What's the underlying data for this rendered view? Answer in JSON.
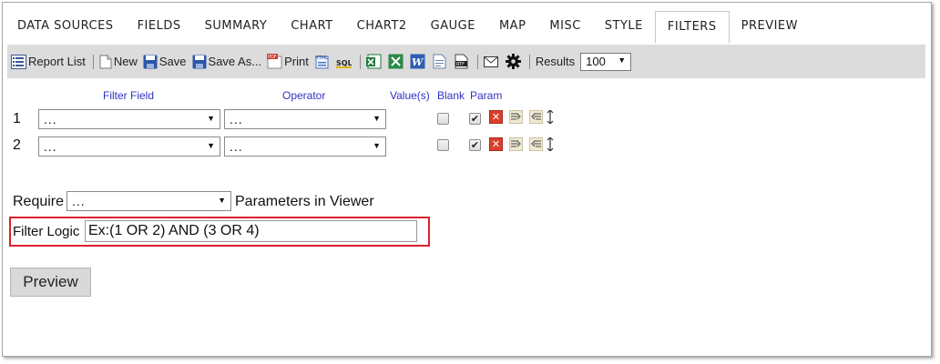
{
  "tabs": [
    {
      "label": "DATA SOURCES"
    },
    {
      "label": "FIELDS"
    },
    {
      "label": "SUMMARY"
    },
    {
      "label": "CHART"
    },
    {
      "label": "CHART2"
    },
    {
      "label": "GAUGE"
    },
    {
      "label": "MAP"
    },
    {
      "label": "MISC"
    },
    {
      "label": "STYLE"
    },
    {
      "label": "FILTERS",
      "active": true
    },
    {
      "label": "PREVIEW"
    }
  ],
  "toolbar": {
    "report_list": "Report List",
    "new": "New",
    "save": "Save",
    "save_as": "Save As...",
    "print": "Print",
    "results_label": "Results",
    "results_value": "100",
    "icons": [
      "report-list-icon",
      "new-icon",
      "save-icon",
      "save-as-icon",
      "pdf-print-icon",
      "html-icon",
      "sql-icon",
      "excel-icon",
      "excel-alt-icon",
      "word-icon",
      "text-icon",
      "rtf-icon",
      "email-icon",
      "gear-icon"
    ]
  },
  "filters": {
    "headers": {
      "field": "Filter Field",
      "operator": "Operator",
      "values": "Value(s)",
      "blank": "Blank",
      "param": "Param"
    },
    "rows": [
      {
        "num": "1",
        "field": "...",
        "operator": "...",
        "blank": false,
        "param": true
      },
      {
        "num": "2",
        "field": "...",
        "operator": "...",
        "blank": false,
        "param": true
      }
    ]
  },
  "require": {
    "label": "Require",
    "value": "...",
    "suffix": "Parameters in Viewer"
  },
  "filter_logic": {
    "label": "Filter Logic",
    "value": "Ex:(1 OR 2) AND (3 OR 4)"
  },
  "preview_button": "Preview",
  "colors": {
    "header_text": "#3131c4",
    "highlight_border": "#d9232e",
    "toolbar_bg": "#dcdcdc",
    "delete_icon": "#d9402c"
  }
}
